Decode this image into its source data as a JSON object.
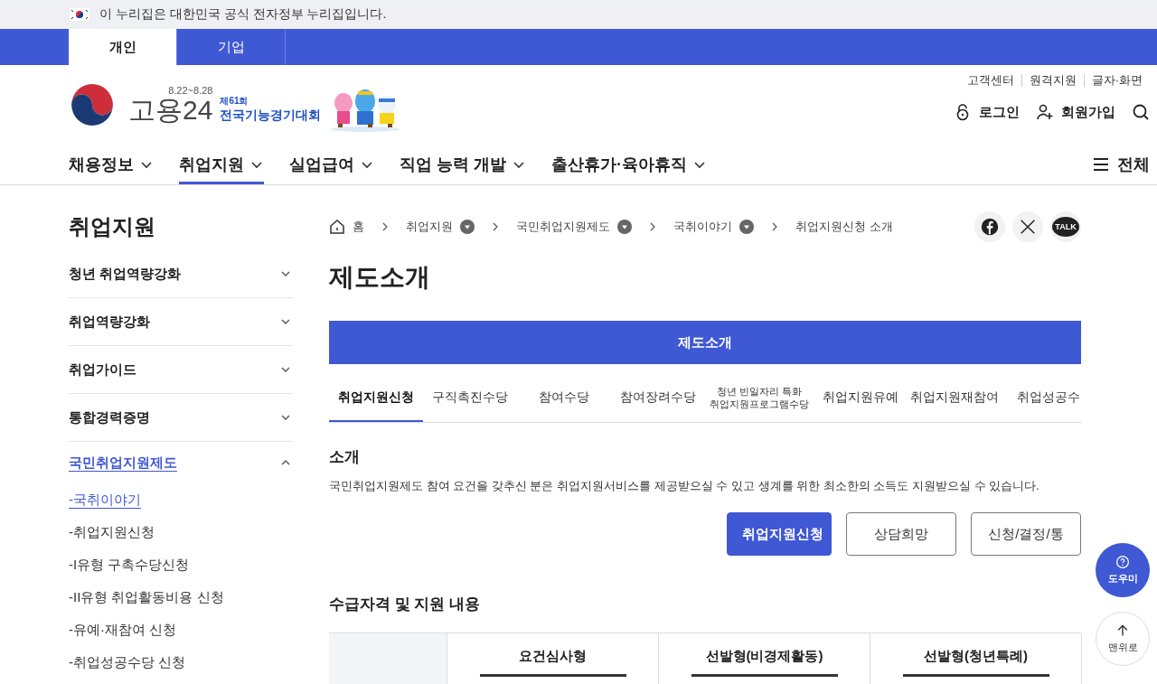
{
  "gov_banner": {
    "text": "이 누리집은 대한민국 공식 전자정부 누리집입니다."
  },
  "audience_tabs": [
    {
      "label": "개인",
      "selected": true
    },
    {
      "label": "기업",
      "selected": false
    }
  ],
  "header": {
    "logo_text": "고용24",
    "event_dates": "8.22~8.28",
    "event_edition": "제61회",
    "event_name": "전국기능경기대회",
    "utility_links": [
      "고객센터",
      "원격지원",
      "글자·화면"
    ],
    "account_links": [
      {
        "label": "로그인",
        "kind": "login"
      },
      {
        "label": "회원가입",
        "kind": "signup"
      }
    ]
  },
  "main_nav": {
    "items": [
      {
        "label": "채용정보",
        "selected": false
      },
      {
        "label": "취업지원",
        "selected": true
      },
      {
        "label": "실업급여",
        "selected": false
      },
      {
        "label": "직업 능력 개발",
        "selected": false
      },
      {
        "label": "출산휴가·육아휴직",
        "selected": false
      }
    ],
    "all_menu": "전체"
  },
  "sidebar": {
    "title": "취업지원",
    "items": [
      {
        "label": "청년 취업역량강화",
        "expanded": false
      },
      {
        "label": "취업역량강화",
        "expanded": false
      },
      {
        "label": "취업가이드",
        "expanded": false
      },
      {
        "label": "통합경력증명",
        "expanded": false
      },
      {
        "label": "국민취업지원제도",
        "expanded": true,
        "children": [
          {
            "label": "-국취이야기",
            "selected": true
          },
          {
            "label": "-취업지원신청",
            "selected": false
          },
          {
            "label": "-I유형 구촉수당신청",
            "selected": false
          },
          {
            "label": "-II유형 취업활동비용 신청",
            "selected": false
          },
          {
            "label": "-유예·재참여 신청",
            "selected": false
          },
          {
            "label": "-취업성공수당 신청",
            "selected": false
          }
        ]
      }
    ]
  },
  "breadcrumb": [
    {
      "label": "홈",
      "kind": "home"
    },
    {
      "label": "취업지원",
      "kind": "menu"
    },
    {
      "label": "국민취업지원제도",
      "kind": "menu"
    },
    {
      "label": "국취이야기",
      "kind": "menu"
    },
    {
      "label": "취업지원신청 소개",
      "kind": "current"
    }
  ],
  "share_buttons": [
    {
      "kind": "facebook"
    },
    {
      "kind": "x"
    },
    {
      "kind": "talk",
      "label": "TALK"
    }
  ],
  "page_title": "제도소개",
  "section_bar": "제도소개",
  "sub_tabs": [
    {
      "label": "취업지원신청",
      "selected": true
    },
    {
      "label": "구직촉진수당",
      "selected": false
    },
    {
      "label": "참여수당",
      "selected": false
    },
    {
      "label": "참여장려수당",
      "selected": false
    },
    {
      "label": "청년 빈일자리 특화\n취업지원프로그램수당",
      "selected": false
    },
    {
      "label": "취업지원유예",
      "selected": false
    },
    {
      "label": "취업지원재참여",
      "selected": false
    },
    {
      "label": "취업성공수",
      "selected": false
    }
  ],
  "intro": {
    "heading": "소개",
    "text": "국민취업지원제도 참여 요건을 갖추신 분은 취업지원서비스를 제공받으실 수 있고 생계를 위한 최소한의 소득도 지원받으실 수 있습니다."
  },
  "action_buttons": [
    {
      "label": "취업지원신청",
      "kind": "primary"
    },
    {
      "label": "상담희망",
      "kind": "outline"
    },
    {
      "label": "신청/결정/통",
      "kind": "outline"
    }
  ],
  "eligibility": {
    "heading": "수급자격 및 지원 내용",
    "columns": [
      "요건심사형",
      "선발형(비경제활동)",
      "선발형(청년특례)"
    ]
  },
  "floating_buttons": [
    {
      "label": "도우미",
      "kind": "help"
    },
    {
      "label": "맨위로",
      "kind": "top"
    }
  ]
}
